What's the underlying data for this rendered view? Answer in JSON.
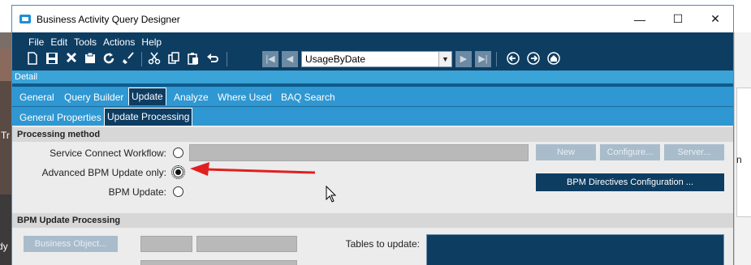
{
  "window": {
    "title": "Business Activity Query Designer",
    "minimize_glyph": "—",
    "maximize_glyph": "☐",
    "close_glyph": "✕"
  },
  "background": {
    "left_text_1": "Tr",
    "left_text_2": "dy",
    "right_letter": "n"
  },
  "menu": {
    "items": [
      "File",
      "Edit",
      "Tools",
      "Actions",
      "Help"
    ]
  },
  "toolbar": {
    "query_selector_value": "UsageByDate"
  },
  "detail_bar": {
    "label": "Detail"
  },
  "tabs_primary": {
    "items": [
      "General",
      "Query Builder",
      "Update",
      "Analyze",
      "Where Used",
      "BAQ Search"
    ],
    "active": "Update"
  },
  "tabs_secondary": {
    "items": [
      "General Properties",
      "Update Processing"
    ],
    "active": "Update Processing"
  },
  "processing_method": {
    "heading": "Processing method",
    "options": [
      {
        "label": "Service Connect Workflow:",
        "checked": false
      },
      {
        "label": "Advanced BPM Update only:",
        "checked": true
      },
      {
        "label": "BPM Update:",
        "checked": false
      }
    ],
    "buttons": {
      "new": "New",
      "configure": "Configure...",
      "server": "Server...",
      "bpm_directives": "BPM Directives Configuration ..."
    }
  },
  "bpm_update_processing": {
    "heading": "BPM Update Processing",
    "business_object_button": "Business Object...",
    "tables_label": "Tables to update:"
  },
  "colors": {
    "window_dark": "#0e3d62",
    "tab_blue": "#2f97d1",
    "detail_blue": "#3aa3d8",
    "annotation_arrow": "#e02020"
  }
}
